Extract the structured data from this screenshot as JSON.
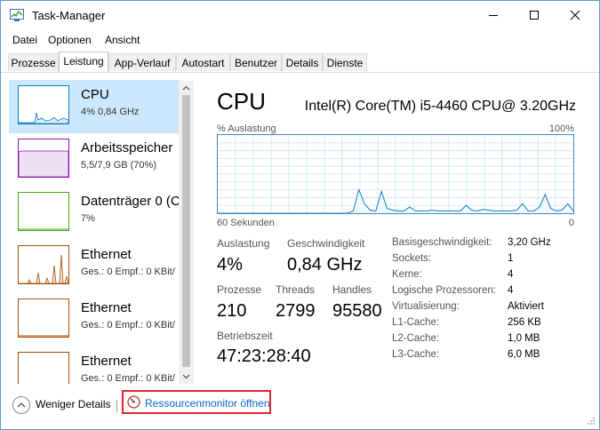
{
  "window": {
    "title": "Task-Manager"
  },
  "menu": [
    "Datei",
    "Optionen",
    "Ansicht"
  ],
  "tabs": [
    "Prozesse",
    "Leistung",
    "App-Verlauf",
    "Autostart",
    "Benutzer",
    "Details",
    "Dienste"
  ],
  "active_tab": "Leistung",
  "sidebar": {
    "items": [
      {
        "title": "CPU",
        "sub": "4% 0,84 GHz",
        "selected": true,
        "color": "#117dbb"
      },
      {
        "title": "Arbeitsspeicher",
        "sub": "5,5/7,9 GB (70%)",
        "selected": false,
        "color": "#8b12ae"
      },
      {
        "title": "Datenträger 0 (C",
        "sub": "7%",
        "selected": false,
        "color": "#4da60c"
      },
      {
        "title": "Ethernet",
        "sub": "Ges.: 0 Empf.: 0 KBit/",
        "selected": false,
        "color": "#a74f01"
      },
      {
        "title": "Ethernet",
        "sub": "Ges.: 0 Empf.: 0 KBit/",
        "selected": false,
        "color": "#a74f01"
      },
      {
        "title": "Ethernet",
        "sub": "Ges.: 0 Empf.: 0 KBit/",
        "selected": false,
        "color": "#a74f01"
      }
    ]
  },
  "main": {
    "title": "CPU",
    "cpu_name": "Intel(R) Core(TM) i5-4460 CPU@ 3.20GHz",
    "graph": {
      "ylabel": "% Auslastung",
      "ymax_label": "100%",
      "xlabel_left": "60 Sekunden",
      "xlabel_right": "0",
      "line_color": "#117dbb",
      "values": [
        0,
        0,
        0,
        0,
        0,
        0,
        0,
        0,
        0,
        0,
        0,
        0,
        0,
        0,
        0,
        0,
        0,
        0,
        0,
        0,
        0,
        0,
        0,
        0,
        3,
        30,
        12,
        4,
        3,
        28,
        6,
        4,
        3,
        3,
        8,
        3,
        3,
        3,
        4,
        3,
        3,
        3,
        3,
        3,
        10,
        4,
        3,
        5,
        4,
        3,
        3,
        3,
        3,
        4,
        12,
        3,
        3,
        8,
        24,
        6,
        3,
        4,
        12,
        3
      ]
    },
    "stats": {
      "auslastung_label": "Auslastung",
      "auslastung_value": "4%",
      "geschwindigkeit_label": "Geschwindigkeit",
      "geschwindigkeit_value": "0,84 GHz",
      "prozesse_label": "Prozesse",
      "prozesse_value": "210",
      "threads_label": "Threads",
      "threads_value": "2799",
      "handles_label": "Handles",
      "handles_value": "95580",
      "betriebszeit_label": "Betriebszeit",
      "betriebszeit_value": "47:23:28:40"
    },
    "info": [
      {
        "label": "Basisgeschwindigkeit:",
        "value": "3,20 GHz"
      },
      {
        "label": "Sockets:",
        "value": "1"
      },
      {
        "label": "Kerne:",
        "value": "4"
      },
      {
        "label": "Logische Prozessoren:",
        "value": "4"
      },
      {
        "label": "Virtualisierung:",
        "value": "Aktiviert"
      },
      {
        "label": "L1-Cache:",
        "value": "256 KB"
      },
      {
        "label": "L2-Cache:",
        "value": "1,0 MB"
      },
      {
        "label": "L3-Cache:",
        "value": "6,0 MB"
      }
    ]
  },
  "footer": {
    "less_details": "Weniger Details",
    "resource_monitor": "Ressourcenmonitor öffnen"
  },
  "icons": {
    "app": "task-manager-icon",
    "less": "chevron-up-icon",
    "resmon": "resource-monitor-icon"
  },
  "colors": {
    "selection": "#cce8ff",
    "highlight_box": "#e0252b",
    "link": "#0a64c8",
    "window_border": "#5f9bd6"
  }
}
